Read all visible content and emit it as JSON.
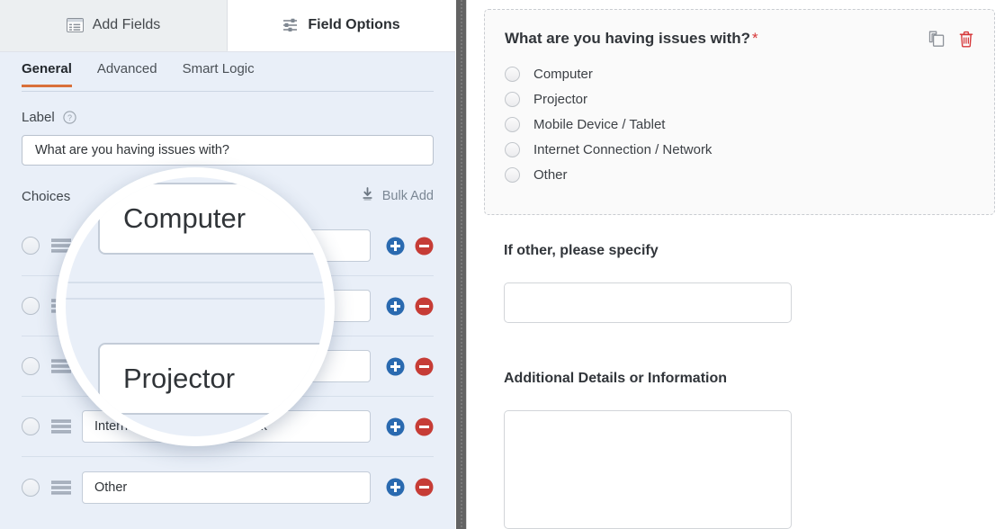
{
  "builder": {
    "tabs": [
      {
        "label": "Add Fields",
        "icon": "list-panel-icon",
        "active": false
      },
      {
        "label": "Field Options",
        "icon": "sliders-icon",
        "active": true
      }
    ],
    "subtabs": [
      {
        "label": "General",
        "active": true
      },
      {
        "label": "Advanced",
        "active": false
      },
      {
        "label": "Smart Logic",
        "active": false
      }
    ],
    "label_section": {
      "title": "Label",
      "help_icon": "question-circle-icon",
      "value": "What are you having issues with?"
    },
    "choices_section": {
      "title": "Choices",
      "bulk_add_label": "Bulk Add",
      "bulk_add_icon": "download-icon",
      "add_icon": "plus-circle-icon",
      "remove_icon": "minus-circle-icon",
      "drag_icon": "drag-handle-icon",
      "radio_icon": "radio-unchecked-icon",
      "items": [
        {
          "value": "Computer"
        },
        {
          "value": "Projector"
        },
        {
          "value": "Mobile Device / Tablet"
        },
        {
          "value": "Internet Connection / Network"
        },
        {
          "value": "Other"
        }
      ]
    }
  },
  "magnifier": {
    "visible_rows": [
      {
        "value": "Computer"
      },
      {
        "value": "Projector"
      }
    ]
  },
  "preview": {
    "field": {
      "title": "What are you having issues with?",
      "required_marker": "*",
      "duplicate_icon": "copy-icon",
      "delete_icon": "trash-icon",
      "options": [
        {
          "label": "Computer"
        },
        {
          "label": "Projector"
        },
        {
          "label": "Mobile Device / Tablet"
        },
        {
          "label": "Internet Connection / Network"
        },
        {
          "label": "Other"
        }
      ]
    },
    "sections": [
      {
        "label": "If other, please specify",
        "type": "text",
        "value": ""
      },
      {
        "label": "Additional Details or Information",
        "type": "textarea",
        "value": ""
      }
    ]
  },
  "colors": {
    "panel_bg": "#e9eff8",
    "accent_orange": "#d9703a",
    "add_blue": "#2a6ab0",
    "remove_red": "#c63c36",
    "required_red": "#d63638",
    "trash_red": "#d63638"
  }
}
